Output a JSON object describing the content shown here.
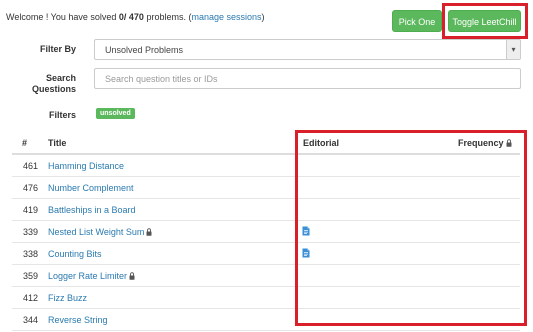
{
  "header": {
    "welcome_prefix": "Welcome ! You have solved ",
    "solved_count": "0/ 470",
    "welcome_suffix": " problems. (",
    "manage_sessions": "manage sessions",
    "close_paren": ")",
    "pick_one_label": "Pick One",
    "toggle_label": "Toggle LeetChill"
  },
  "form": {
    "filter_by_label": "Filter By",
    "filter_value": "Unsolved Problems",
    "search_label_1": "Search",
    "search_label_2": "Questions",
    "search_placeholder": "Search question titles or IDs",
    "filters_label": "Filters",
    "badge": "unsolved"
  },
  "table": {
    "headers": {
      "num": "#",
      "title": "Title",
      "editorial": "Editorial",
      "frequency": "Frequency"
    },
    "rows": [
      {
        "num": "461",
        "title": "Hamming Distance",
        "locked": false,
        "editorial": false
      },
      {
        "num": "476",
        "title": "Number Complement",
        "locked": false,
        "editorial": false
      },
      {
        "num": "419",
        "title": "Battleships in a Board",
        "locked": false,
        "editorial": false
      },
      {
        "num": "339",
        "title": "Nested List Weight Sum",
        "locked": true,
        "editorial": true
      },
      {
        "num": "338",
        "title": "Counting Bits",
        "locked": false,
        "editorial": true
      },
      {
        "num": "359",
        "title": "Logger Rate Limiter",
        "locked": true,
        "editorial": false
      },
      {
        "num": "412",
        "title": "Fizz Buzz",
        "locked": false,
        "editorial": false
      },
      {
        "num": "344",
        "title": "Reverse String",
        "locked": false,
        "editorial": false
      }
    ]
  },
  "colors": {
    "link": "#2a7ab0",
    "button": "#5cb85c",
    "highlight": "#d9202a",
    "doc_icon": "#3a8fd6"
  }
}
